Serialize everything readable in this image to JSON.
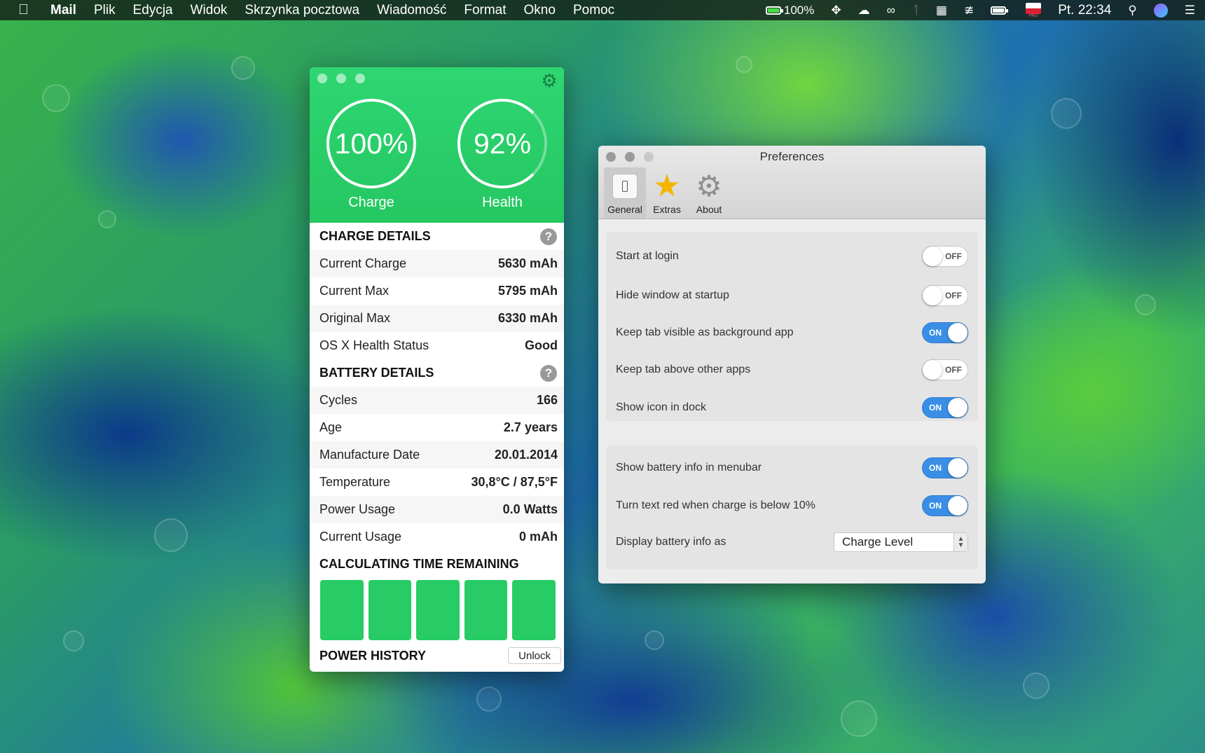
{
  "menubar": {
    "app": "Mail",
    "items": [
      "Plik",
      "Edycja",
      "Widok",
      "Skrzynka pocztowa",
      "Wiadomość",
      "Format",
      "Okno",
      "Pomoc"
    ],
    "battery_percent": "100%",
    "flag_label": "PRO",
    "clock": "Pt. 22:34"
  },
  "battery_app": {
    "charge_ring": "100%",
    "charge_label": "Charge",
    "health_ring": "92%",
    "health_label": "Health",
    "charge_details": {
      "title": "CHARGE DETAILS",
      "rows": [
        {
          "label": "Current Charge",
          "value": "5630 mAh"
        },
        {
          "label": "Current Max",
          "value": "5795 mAh"
        },
        {
          "label": "Original Max",
          "value": "6330 mAh"
        },
        {
          "label": "OS X Health Status",
          "value": "Good"
        }
      ]
    },
    "battery_details": {
      "title": "BATTERY DETAILS",
      "rows": [
        {
          "label": "Cycles",
          "value": "166"
        },
        {
          "label": "Age",
          "value": "2.7 years"
        },
        {
          "label": "Manufacture Date",
          "value": "20.01.2014"
        },
        {
          "label": "Temperature",
          "value": "30,8°C / 87,5°F"
        },
        {
          "label": "Power Usage",
          "value": "0.0 Watts"
        },
        {
          "label": "Current Usage",
          "value": "0 mAh"
        }
      ]
    },
    "time_remaining_title": "CALCULATING TIME REMAINING",
    "power_history_title": "POWER HISTORY",
    "unlock_label": "Unlock",
    "accent_color": "#27cc64"
  },
  "preferences": {
    "title": "Preferences",
    "tabs": [
      {
        "label": "General",
        "icon": "switch-icon"
      },
      {
        "label": "Extras",
        "icon": "star-icon"
      },
      {
        "label": "About",
        "icon": "gear-icon"
      }
    ],
    "group1": [
      {
        "label": "Start at login",
        "state": "OFF"
      },
      {
        "label": "Hide window at startup",
        "state": "OFF"
      },
      {
        "label": "Keep tab visible as background app",
        "state": "ON"
      },
      {
        "label": "Keep tab above other apps",
        "state": "OFF"
      },
      {
        "label": "Show icon in dock",
        "state": "ON"
      }
    ],
    "group2": [
      {
        "label": "Show battery info in menubar",
        "state": "ON"
      },
      {
        "label": "Turn text red when charge is below 10%",
        "state": "ON"
      }
    ],
    "display_label": "Display battery info as",
    "display_value": "Charge Level",
    "toggle_on_color": "#3a8ee6"
  }
}
